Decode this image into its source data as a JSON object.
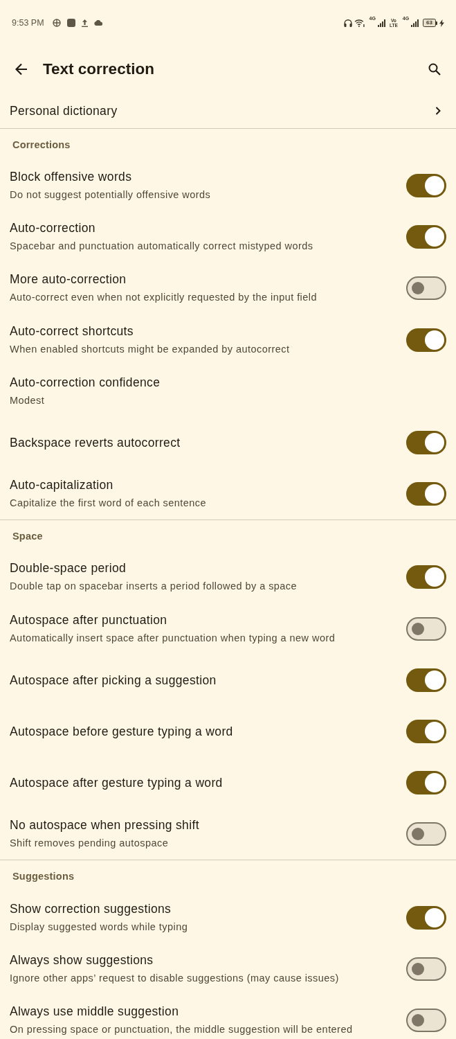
{
  "status_bar": {
    "time": "9:53 PM",
    "sim1_network": "4G",
    "volte_top": "Vo",
    "volte_bottom": "LTE",
    "sim2_network": "4G",
    "battery": "63",
    "charging": true
  },
  "toolbar": {
    "title": "Text correction"
  },
  "sections": [
    {
      "items": [
        {
          "kind": "link",
          "title": "Personal dictionary"
        }
      ]
    },
    {
      "header": "Corrections",
      "items": [
        {
          "kind": "switch",
          "title": "Block offensive words",
          "summary": "Do not suggest potentially offensive words",
          "on": true
        },
        {
          "kind": "switch",
          "title": "Auto-correction",
          "summary": "Spacebar and punctuation automatically correct mistyped words",
          "on": true
        },
        {
          "kind": "switch",
          "title": "More auto-correction",
          "summary": "Auto-correct even when not explicitly requested by the input field",
          "on": false
        },
        {
          "kind": "switch",
          "title": "Auto-correct shortcuts",
          "summary": "When enabled shortcuts might be expanded by autocorrect",
          "on": true
        },
        {
          "kind": "choice",
          "title": "Auto-correction confidence",
          "summary": "Modest"
        },
        {
          "kind": "switch",
          "title": "Backspace reverts autocorrect",
          "on": true
        },
        {
          "kind": "switch",
          "title": "Auto-capitalization",
          "summary": "Capitalize the first word of each sentence",
          "on": true
        }
      ]
    },
    {
      "header": "Space",
      "items": [
        {
          "kind": "switch",
          "title": "Double-space period",
          "summary": "Double tap on spacebar inserts a period followed by a space",
          "on": true
        },
        {
          "kind": "switch",
          "title": "Autospace after punctuation",
          "summary": "Automatically insert space after punctuation when typing a new word",
          "on": false
        },
        {
          "kind": "switch",
          "title": "Autospace after picking a suggestion",
          "on": true
        },
        {
          "kind": "switch",
          "title": "Autospace before gesture typing a word",
          "on": true
        },
        {
          "kind": "switch",
          "title": "Autospace after gesture typing a word",
          "on": true
        },
        {
          "kind": "switch",
          "title": "No autospace when pressing shift",
          "summary": "Shift removes pending autospace",
          "on": false
        }
      ]
    },
    {
      "header": "Suggestions",
      "items": [
        {
          "kind": "switch",
          "title": "Show correction suggestions",
          "summary": "Display suggested words while typing",
          "on": true
        },
        {
          "kind": "switch",
          "title": "Always show suggestions",
          "summary": "Ignore other apps’ request to disable suggestions (may cause issues)",
          "on": false
        },
        {
          "kind": "switch",
          "title": "Always use middle suggestion",
          "summary": "On pressing space or punctuation, the middle suggestion will be entered",
          "on": false
        }
      ]
    }
  ]
}
